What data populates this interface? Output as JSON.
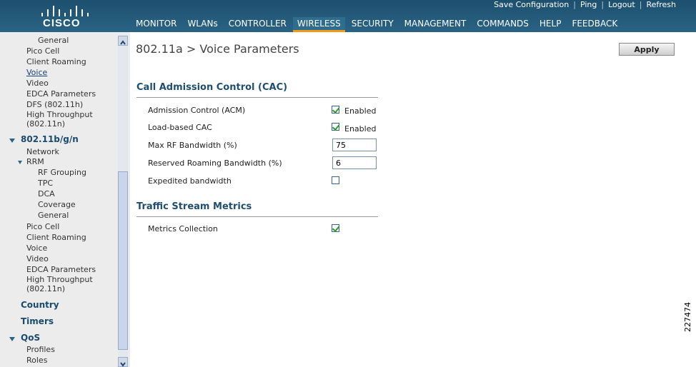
{
  "app": {
    "logo_text": "CISCO"
  },
  "toplinks": [
    {
      "label": "Save Configuration"
    },
    {
      "label": "Ping"
    },
    {
      "label": "Logout"
    },
    {
      "label": "Refresh"
    }
  ],
  "nav": [
    {
      "label": "MONITOR"
    },
    {
      "label": "WLANs"
    },
    {
      "label": "CONTROLLER"
    },
    {
      "label": "WIRELESS"
    },
    {
      "label": "SECURITY"
    },
    {
      "label": "MANAGEMENT"
    },
    {
      "label": "COMMANDS"
    },
    {
      "label": "HELP"
    },
    {
      "label": "FEEDBACK"
    }
  ],
  "nav_active": "WIRELESS",
  "sidebar": {
    "items_a": [
      "General",
      "Pico Cell",
      "Client Roaming",
      "Voice",
      "Video",
      "EDCA Parameters",
      "DFS (802.11h)",
      "High Throughput",
      "(802.11n)"
    ],
    "section_bgn": "802.11b/g/n",
    "items_b": [
      "Network",
      "RRM"
    ],
    "rrm_items": [
      "RF Grouping",
      "TPC",
      "DCA",
      "Coverage",
      "General"
    ],
    "items_c": [
      "Pico Cell",
      "Client Roaming",
      "Voice",
      "Video",
      "EDCA Parameters",
      "High Throughput",
      "(802.11n)"
    ],
    "country": "Country",
    "timers": "Timers",
    "qos": "QoS",
    "qos_items": [
      "Profiles",
      "Roles"
    ]
  },
  "main": {
    "title": "802.11a > Voice Parameters",
    "apply": "Apply",
    "cac": {
      "heading": "Call Admission Control (CAC)",
      "acm_label": "Admission Control (ACM)",
      "acm_text": "Enabled",
      "acm_checked": true,
      "lb_label": "Load-based CAC",
      "lb_text": "Enabled",
      "lb_checked": true,
      "maxrf_label": "Max RF Bandwidth (%)",
      "maxrf_value": "75",
      "rrb_label": "Reserved Roaming Bandwidth (%)",
      "rrb_value": "6",
      "exp_label": "Expedited bandwidth",
      "exp_checked": false
    },
    "tsm": {
      "heading": "Traffic Stream Metrics",
      "metrics_label": "Metrics Collection",
      "metrics_checked": true
    }
  },
  "side_number": "227474"
}
